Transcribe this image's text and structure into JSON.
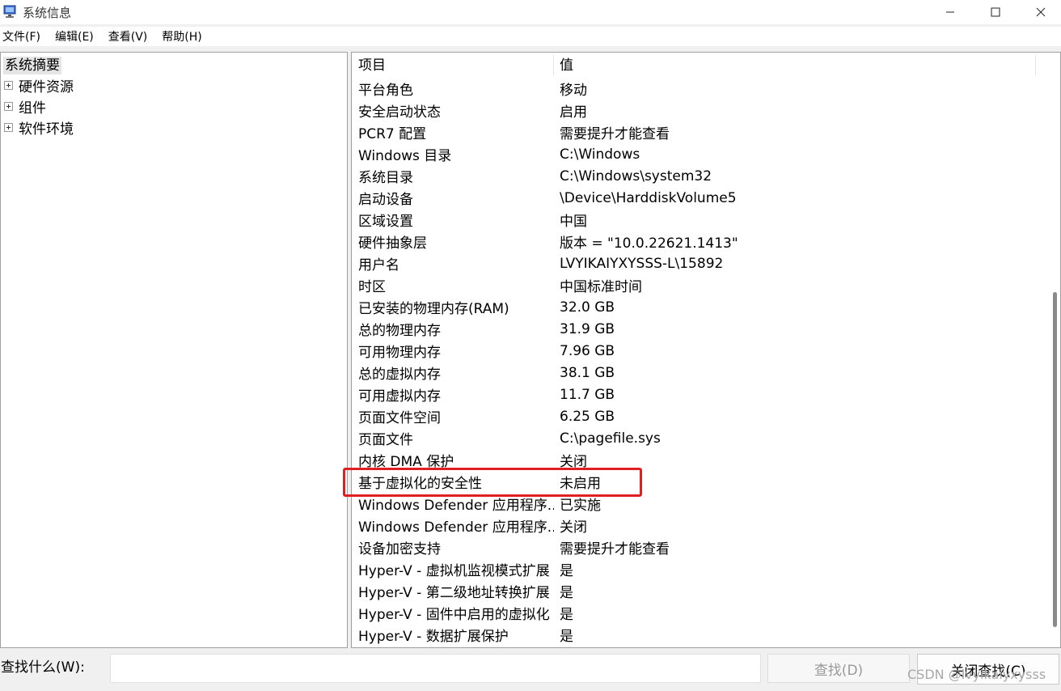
{
  "window": {
    "title": "系统信息",
    "min_icon": "minimize-icon",
    "max_icon": "maximize-icon",
    "close_icon": "close-icon"
  },
  "menu": [
    {
      "label": "文件(F)"
    },
    {
      "label": "编辑(E)"
    },
    {
      "label": "查看(V)"
    },
    {
      "label": "帮助(H)"
    }
  ],
  "tree": {
    "root": "系统摘要",
    "children": [
      {
        "label": "硬件资源"
      },
      {
        "label": "组件"
      },
      {
        "label": "软件环境"
      }
    ]
  },
  "table": {
    "headers": {
      "item": "项目",
      "value": "值"
    },
    "rows": [
      {
        "item": "平台角色",
        "value": "移动"
      },
      {
        "item": "安全启动状态",
        "value": "启用"
      },
      {
        "item": "PCR7 配置",
        "value": "需要提升才能查看"
      },
      {
        "item": "Windows 目录",
        "value": "C:\\Windows"
      },
      {
        "item": "系统目录",
        "value": "C:\\Windows\\system32"
      },
      {
        "item": "启动设备",
        "value": "\\Device\\HarddiskVolume5"
      },
      {
        "item": "区域设置",
        "value": "中国"
      },
      {
        "item": "硬件抽象层",
        "value": "版本 = \"10.0.22621.1413\""
      },
      {
        "item": "用户名",
        "value": "LVYIKAIYXYSSS-L\\15892"
      },
      {
        "item": "时区",
        "value": "中国标准时间"
      },
      {
        "item": "已安装的物理内存(RAM)",
        "value": "32.0 GB"
      },
      {
        "item": "总的物理内存",
        "value": "31.9 GB"
      },
      {
        "item": "可用物理内存",
        "value": "7.96 GB"
      },
      {
        "item": "总的虚拟内存",
        "value": "38.1 GB"
      },
      {
        "item": "可用虚拟内存",
        "value": "11.7 GB"
      },
      {
        "item": "页面文件空间",
        "value": "6.25 GB"
      },
      {
        "item": "页面文件",
        "value": "C:\\pagefile.sys"
      },
      {
        "item": "内核 DMA 保护",
        "value": "关闭"
      },
      {
        "item": "基于虚拟化的安全性",
        "value": "未启用"
      },
      {
        "item": "Windows Defender 应用程序...",
        "value": "已实施"
      },
      {
        "item": "Windows Defender 应用程序...",
        "value": "关闭"
      },
      {
        "item": "设备加密支持",
        "value": "需要提升才能查看"
      },
      {
        "item": "Hyper-V - 虚拟机监视模式扩展",
        "value": "是"
      },
      {
        "item": "Hyper-V - 第二级地址转换扩展",
        "value": "是"
      },
      {
        "item": "Hyper-V - 固件中启用的虚拟化",
        "value": "是"
      },
      {
        "item": "Hyper-V - 数据扩展保护",
        "value": "是"
      }
    ]
  },
  "find": {
    "label": "查找什么(W):",
    "input_value": "",
    "find_button": "查找(D)",
    "close_button": "关闭查找(C)"
  },
  "watermark": "CSDN @lvyikaiyxysss",
  "colors": {
    "highlight_border": "#e02020",
    "selected_bg": "#e5e5e5"
  }
}
